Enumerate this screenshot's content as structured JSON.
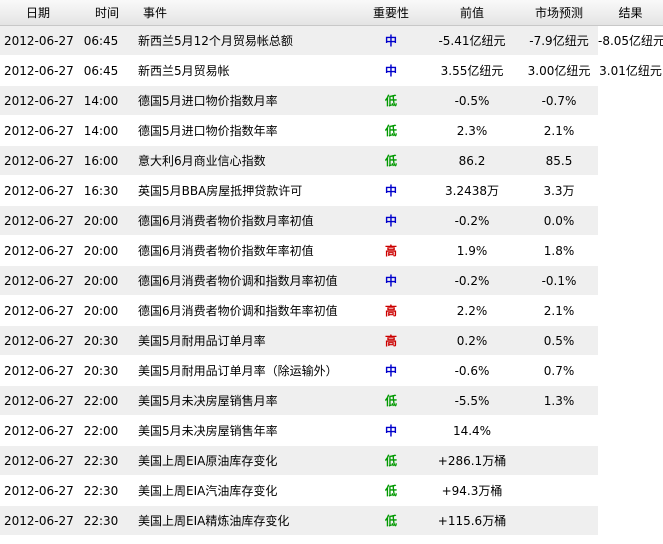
{
  "columns": {
    "date": "日期",
    "time": "时间",
    "event": "事件",
    "importance": "重要性",
    "previous": "前值",
    "forecast": "市场预测",
    "result": "结果"
  },
  "importance_colors": {
    "低": "#009900",
    "中": "#0000cc",
    "高": "#cc0000"
  },
  "rows": [
    {
      "date": "2012-06-27",
      "time": "06:45",
      "event": "新西兰5月12个月贸易帐总额",
      "importance": "中",
      "previous": "-5.41亿纽元",
      "forecast": "-7.9亿纽元",
      "result": "-8.05亿纽元"
    },
    {
      "date": "2012-06-27",
      "time": "06:45",
      "event": "新西兰5月贸易帐",
      "importance": "中",
      "previous": "3.55亿纽元",
      "forecast": "3.00亿纽元",
      "result": "3.01亿纽元"
    },
    {
      "date": "2012-06-27",
      "time": "14:00",
      "event": "德国5月进口物价指数月率",
      "importance": "低",
      "previous": "-0.5%",
      "forecast": "-0.7%",
      "result": ""
    },
    {
      "date": "2012-06-27",
      "time": "14:00",
      "event": "德国5月进口物价指数年率",
      "importance": "低",
      "previous": "2.3%",
      "forecast": "2.1%",
      "result": ""
    },
    {
      "date": "2012-06-27",
      "time": "16:00",
      "event": "意大利6月商业信心指数",
      "importance": "低",
      "previous": "86.2",
      "forecast": "85.5",
      "result": ""
    },
    {
      "date": "2012-06-27",
      "time": "16:30",
      "event": "英国5月BBA房屋抵押贷款许可",
      "importance": "中",
      "previous": "3.2438万",
      "forecast": "3.3万",
      "result": ""
    },
    {
      "date": "2012-06-27",
      "time": "20:00",
      "event": "德国6月消费者物价指数月率初值",
      "importance": "中",
      "previous": "-0.2%",
      "forecast": "0.0%",
      "result": ""
    },
    {
      "date": "2012-06-27",
      "time": "20:00",
      "event": "德国6月消费者物价指数年率初值",
      "importance": "高",
      "previous": "1.9%",
      "forecast": "1.8%",
      "result": ""
    },
    {
      "date": "2012-06-27",
      "time": "20:00",
      "event": "德国6月消费者物价调和指数月率初值",
      "importance": "中",
      "previous": "-0.2%",
      "forecast": "-0.1%",
      "result": ""
    },
    {
      "date": "2012-06-27",
      "time": "20:00",
      "event": "德国6月消费者物价调和指数年率初值",
      "importance": "高",
      "previous": "2.2%",
      "forecast": "2.1%",
      "result": ""
    },
    {
      "date": "2012-06-27",
      "time": "20:30",
      "event": "美国5月耐用品订单月率",
      "importance": "高",
      "previous": "0.2%",
      "forecast": "0.5%",
      "result": ""
    },
    {
      "date": "2012-06-27",
      "time": "20:30",
      "event": "美国5月耐用品订单月率（除运输外）",
      "importance": "中",
      "previous": "-0.6%",
      "forecast": "0.7%",
      "result": ""
    },
    {
      "date": "2012-06-27",
      "time": "22:00",
      "event": "美国5月未决房屋销售月率",
      "importance": "低",
      "previous": "-5.5%",
      "forecast": "1.3%",
      "result": ""
    },
    {
      "date": "2012-06-27",
      "time": "22:00",
      "event": "美国5月未决房屋销售年率",
      "importance": "中",
      "previous": "14.4%",
      "forecast": "",
      "result": ""
    },
    {
      "date": "2012-06-27",
      "time": "22:30",
      "event": "美国上周EIA原油库存变化",
      "importance": "低",
      "previous": "+286.1万桶",
      "forecast": "",
      "result": ""
    },
    {
      "date": "2012-06-27",
      "time": "22:30",
      "event": "美国上周EIA汽油库存变化",
      "importance": "低",
      "previous": "+94.3万桶",
      "forecast": "",
      "result": ""
    },
    {
      "date": "2012-06-27",
      "time": "22:30",
      "event": "美国上周EIA精炼油库存变化",
      "importance": "低",
      "previous": "+115.6万桶",
      "forecast": "",
      "result": ""
    }
  ]
}
